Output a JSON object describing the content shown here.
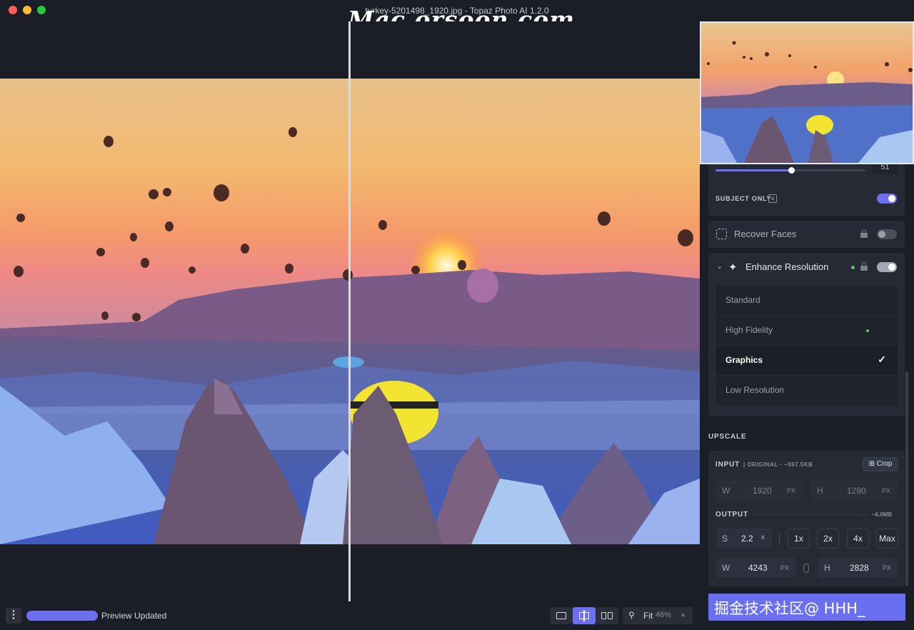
{
  "window": {
    "title": "turkey-5201498_1920.jpg - Topaz Photo AI 1.2.0",
    "watermark": "Mac.orsoon.com"
  },
  "panel": {
    "slider_value": "51",
    "subject_only_label": "SUBJECT ONLY",
    "recover_faces": {
      "label": "Recover Faces",
      "enabled": false
    },
    "enhance_resolution": {
      "label": "Enhance Resolution",
      "enabled": true,
      "models": [
        {
          "label": "Standard",
          "selected": false
        },
        {
          "label": "High Fidelity",
          "selected": false,
          "recommended": true
        },
        {
          "label": "Graphics",
          "selected": true
        },
        {
          "label": "Low Resolution",
          "selected": false
        }
      ]
    },
    "upscale": {
      "section_label": "UPSCALE",
      "input_label": "INPUT",
      "input_meta": "| ORIGINAL · ~597.5KB",
      "crop_label": "Crop",
      "input_w_label": "W",
      "input_w": "1920",
      "input_h_label": "H",
      "input_h": "1280",
      "unit": "PX",
      "output_label": "OUTPUT",
      "output_size": "~6.0MB",
      "scale_label": "S",
      "scale_value": "2.2",
      "scale_unit": "x",
      "presets": [
        "1x",
        "2x",
        "4x",
        "Max"
      ],
      "output_w_label": "W",
      "output_w": "4243",
      "output_h_label": "H",
      "output_h": "2828"
    }
  },
  "status": {
    "preview_text": "Preview Updated",
    "zoom_label": "Fit",
    "zoom_value": "46%"
  },
  "overlay_badge": "掘金技术社区@ HHH_",
  "colors": {
    "accent": "#6d6ff2",
    "background": "#1b1e26",
    "card": "#262a35"
  }
}
